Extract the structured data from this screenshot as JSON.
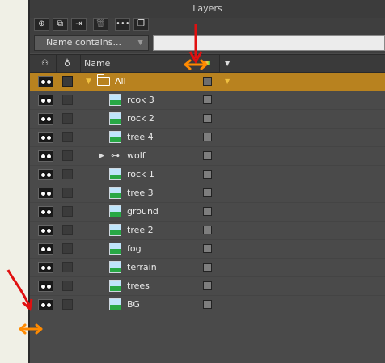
{
  "panel": {
    "title": "Layers"
  },
  "toolbar": {
    "buttons": [
      {
        "name": "new-layer-button",
        "glyph": "⊕"
      },
      {
        "name": "duplicate-layer-button",
        "glyph": "⧉"
      },
      {
        "name": "import-layer-button",
        "glyph": "⇥"
      },
      {
        "name": "delete-layer-button",
        "glyph": "🗑"
      },
      {
        "name": "more-options-button",
        "glyph": "•••"
      },
      {
        "name": "copy-layer-button",
        "glyph": "❐"
      }
    ]
  },
  "filter": {
    "select_label": "Name contains...",
    "input_value": ""
  },
  "header": {
    "name_label": "Name"
  },
  "layers": [
    {
      "name": "All",
      "type": "folder",
      "selected": true,
      "expanded": true
    },
    {
      "name": "rcok 3",
      "type": "image"
    },
    {
      "name": "rock 2",
      "type": "image"
    },
    {
      "name": "tree 4",
      "type": "image"
    },
    {
      "name": "wolf",
      "type": "bones",
      "collapsed": true
    },
    {
      "name": "rock 1",
      "type": "image"
    },
    {
      "name": "tree 3",
      "type": "image"
    },
    {
      "name": "ground",
      "type": "image"
    },
    {
      "name": "tree 2",
      "type": "image"
    },
    {
      "name": "fog",
      "type": "image"
    },
    {
      "name": "terrain",
      "type": "image"
    },
    {
      "name": "trees",
      "type": "image"
    },
    {
      "name": "BG",
      "type": "image"
    }
  ],
  "colors": {
    "selection": "#b8821f",
    "annotation_red": "#e01010",
    "annotation_orange": "#ff8a00"
  }
}
